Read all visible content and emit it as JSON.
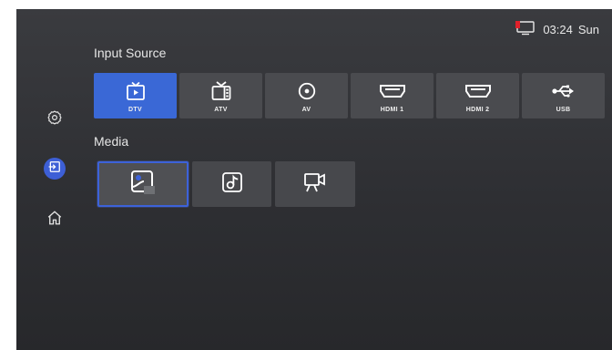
{
  "status": {
    "time": "03:24",
    "day": "Sun",
    "tv_icon": "tv-indicator-icon",
    "indicator_color": "#e0202a"
  },
  "sidebar": {
    "items": [
      {
        "name": "settings",
        "icon": "gear-icon",
        "active": false
      },
      {
        "name": "input-source",
        "icon": "input-icon",
        "active": true
      },
      {
        "name": "home",
        "icon": "home-icon",
        "active": false
      }
    ],
    "accent": "#3d5fd6"
  },
  "sections": {
    "input_title": "Input Source",
    "media_title": "Media"
  },
  "inputs": [
    {
      "label": "DTV",
      "icon": "dtv-icon",
      "active": true
    },
    {
      "label": "ATV",
      "icon": "atv-icon",
      "active": false
    },
    {
      "label": "AV",
      "icon": "av-icon",
      "active": false
    },
    {
      "label": "HDMI 1",
      "icon": "hdmi-icon",
      "active": false
    },
    {
      "label": "HDMI 2",
      "icon": "hdmi-icon",
      "active": false
    },
    {
      "label": "USB",
      "icon": "usb-icon",
      "active": false
    }
  ],
  "media": [
    {
      "icon": "photo-icon",
      "focused": true
    },
    {
      "icon": "music-icon",
      "focused": false
    },
    {
      "icon": "video-icon",
      "focused": false
    }
  ]
}
